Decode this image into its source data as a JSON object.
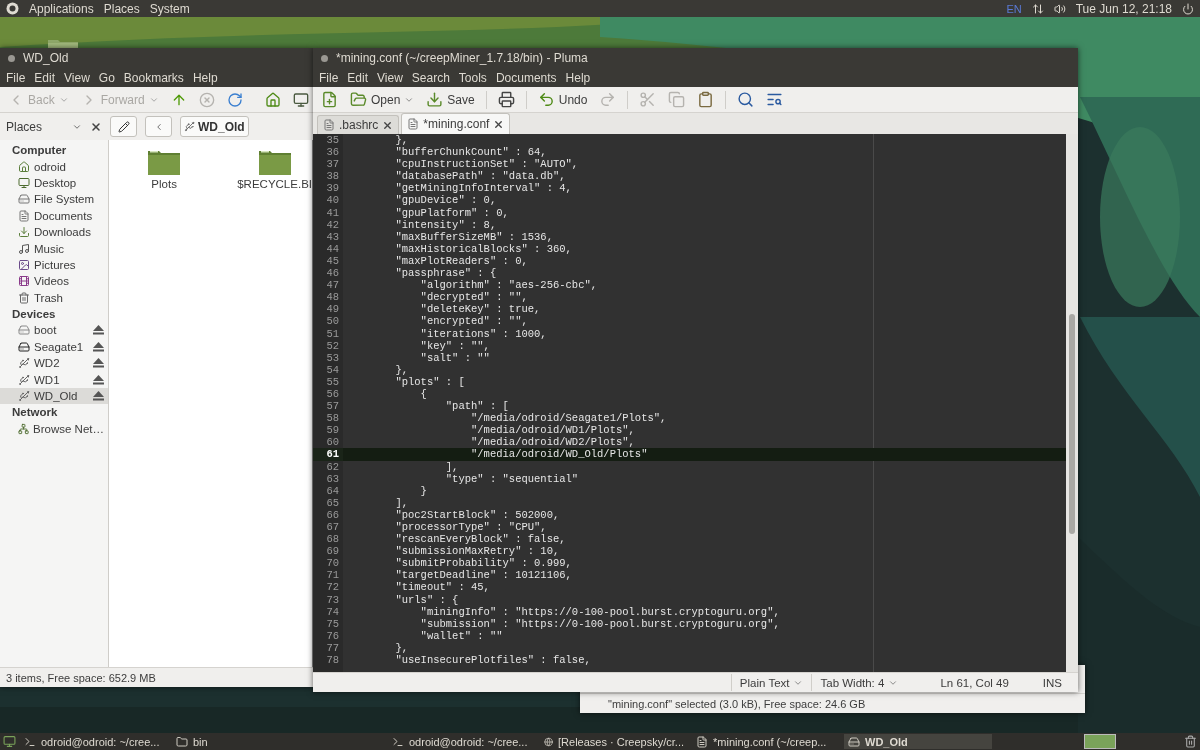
{
  "top_panel": {
    "menus": [
      "Applications",
      "Places",
      "System"
    ],
    "keyboard": "EN",
    "clock": "Tue Jun 12, 21:18"
  },
  "file_manager": {
    "title": "WD_Old",
    "menu": [
      "File",
      "Edit",
      "View",
      "Go",
      "Bookmarks",
      "Help"
    ],
    "toolbar": [
      {
        "kind": "back",
        "label": "Back",
        "disabled": true,
        "menu": true
      },
      {
        "kind": "forward",
        "label": "Forward",
        "disabled": true,
        "menu": true
      },
      {
        "kind": "up",
        "disabled": false
      },
      {
        "kind": "stop",
        "disabled": true
      },
      {
        "kind": "reload",
        "disabled": false
      },
      {
        "kind": "home",
        "disabled": false
      },
      {
        "kind": "computer",
        "disabled": false
      }
    ],
    "places_label": "Places",
    "path_button": "WD_Old",
    "sidebar": [
      {
        "heading": "Computer",
        "items": [
          {
            "label": "odroid",
            "kind": "home",
            "selected": false
          },
          {
            "label": "Desktop",
            "kind": "desktop",
            "selected": false
          },
          {
            "label": "File System",
            "kind": "filesystem",
            "selected": false
          },
          {
            "label": "Documents",
            "kind": "documents",
            "selected": false
          },
          {
            "label": "Downloads",
            "kind": "downloads",
            "selected": false
          },
          {
            "label": "Music",
            "kind": "music",
            "selected": false
          },
          {
            "label": "Pictures",
            "kind": "pictures",
            "selected": false
          },
          {
            "label": "Videos",
            "kind": "videos",
            "selected": false
          },
          {
            "label": "Trash",
            "kind": "trash",
            "selected": false
          }
        ]
      },
      {
        "heading": "Devices",
        "items": [
          {
            "label": "boot",
            "kind": "drive",
            "selected": false,
            "eject": true
          },
          {
            "label": "Seagate1",
            "kind": "disk",
            "selected": false,
            "eject": true
          },
          {
            "label": "WD2",
            "kind": "usb",
            "selected": false,
            "eject": true
          },
          {
            "label": "WD1",
            "kind": "usb",
            "selected": false,
            "eject": true
          },
          {
            "label": "WD_Old",
            "kind": "usb",
            "selected": true,
            "eject": true
          }
        ]
      },
      {
        "heading": "Network",
        "items": [
          {
            "label": "Browse Net…",
            "kind": "network",
            "selected": false
          }
        ]
      }
    ],
    "files": [
      {
        "name": "Plots"
      },
      {
        "name": "$RECYCLE.BI"
      }
    ],
    "status": "3 items, Free space: 652.9 MB"
  },
  "editor": {
    "title": "*mining.conf (~/creepMiner_1.7.18/bin) - Pluma",
    "menu": [
      "File",
      "Edit",
      "View",
      "Search",
      "Tools",
      "Documents",
      "Help"
    ],
    "toolbar": [
      [
        {
          "kind": "new",
          "disabled": false
        },
        {
          "kind": "open",
          "label": "Open",
          "menu": true,
          "disabled": false
        },
        {
          "kind": "save",
          "label": "Save",
          "disabled": false
        }
      ],
      [
        {
          "kind": "print",
          "disabled": false
        }
      ],
      [
        {
          "kind": "undo",
          "label": "Undo",
          "disabled": false
        },
        {
          "kind": "redo",
          "disabled": true
        }
      ],
      [
        {
          "kind": "cut",
          "disabled": true
        },
        {
          "kind": "copy",
          "disabled": true
        },
        {
          "kind": "paste",
          "disabled": false
        }
      ],
      [
        {
          "kind": "find",
          "disabled": false
        },
        {
          "kind": "replace",
          "disabled": false
        }
      ]
    ],
    "tabs": [
      {
        "label": ".bashrc",
        "selected": false
      },
      {
        "label": "*mining.conf",
        "selected": true
      }
    ],
    "lines": [
      {
        "number": "35",
        "text": "        },",
        "current": false
      },
      {
        "number": "36",
        "text": "        \"bufferChunkCount\" : 64,",
        "current": false
      },
      {
        "number": "37",
        "text": "        \"cpuInstructionSet\" : \"AUTO\",",
        "current": false
      },
      {
        "number": "38",
        "text": "        \"databasePath\" : \"data.db\",",
        "current": false
      },
      {
        "number": "39",
        "text": "        \"getMiningInfoInterval\" : 4,",
        "current": false
      },
      {
        "number": "40",
        "text": "        \"gpuDevice\" : 0,",
        "current": false
      },
      {
        "number": "41",
        "text": "        \"gpuPlatform\" : 0,",
        "current": false
      },
      {
        "number": "42",
        "text": "        \"intensity\" : 8,",
        "current": false
      },
      {
        "number": "43",
        "text": "        \"maxBufferSizeMB\" : 1536,",
        "current": false
      },
      {
        "number": "44",
        "text": "        \"maxHistoricalBlocks\" : 360,",
        "current": false
      },
      {
        "number": "45",
        "text": "        \"maxPlotReaders\" : 0,",
        "current": false
      },
      {
        "number": "46",
        "text": "        \"passphrase\" : {",
        "current": false
      },
      {
        "number": "47",
        "text": "            \"algorithm\" : \"aes-256-cbc\",",
        "current": false
      },
      {
        "number": "48",
        "text": "            \"decrypted\" : \"\",",
        "current": false
      },
      {
        "number": "49",
        "text": "            \"deleteKey\" : true,",
        "current": false
      },
      {
        "number": "50",
        "text": "            \"encrypted\" : \"\",",
        "current": false
      },
      {
        "number": "51",
        "text": "            \"iterations\" : 1000,",
        "current": false
      },
      {
        "number": "52",
        "text": "            \"key\" : \"\",",
        "current": false
      },
      {
        "number": "53",
        "text": "            \"salt\" : \"\"",
        "current": false
      },
      {
        "number": "54",
        "text": "        },",
        "current": false
      },
      {
        "number": "55",
        "text": "        \"plots\" : [",
        "current": false
      },
      {
        "number": "56",
        "text": "            {",
        "current": false
      },
      {
        "number": "57",
        "text": "                \"path\" : [",
        "current": false
      },
      {
        "number": "58",
        "text": "                    \"/media/odroid/Seagate1/Plots\",",
        "current": false
      },
      {
        "number": "59",
        "text": "                    \"/media/odroid/WD1/Plots\",",
        "current": false
      },
      {
        "number": "60",
        "text": "                    \"/media/odroid/WD2/Plots\",",
        "current": false
      },
      {
        "number": "61",
        "text": "                    \"/media/odroid/WD_Old/Plots\"",
        "current": true
      },
      {
        "number": "62",
        "text": "                ],",
        "current": false
      },
      {
        "number": "63",
        "text": "                \"type\" : \"sequential\"",
        "current": false
      },
      {
        "number": "64",
        "text": "            }",
        "current": false
      },
      {
        "number": "65",
        "text": "        ],",
        "current": false
      },
      {
        "number": "66",
        "text": "        \"poc2StartBlock\" : 502000,",
        "current": false
      },
      {
        "number": "67",
        "text": "        \"processorType\" : \"CPU\",",
        "current": false
      },
      {
        "number": "68",
        "text": "        \"rescanEveryBlock\" : false,",
        "current": false
      },
      {
        "number": "69",
        "text": "        \"submissionMaxRetry\" : 10,",
        "current": false
      },
      {
        "number": "70",
        "text": "        \"submitProbability\" : 0.999,",
        "current": false
      },
      {
        "number": "71",
        "text": "        \"targetDeadline\" : 10121106,",
        "current": false
      },
      {
        "number": "72",
        "text": "        \"timeout\" : 45,",
        "current": false
      },
      {
        "number": "73",
        "text": "        \"urls\" : {",
        "current": false
      },
      {
        "number": "74",
        "text": "            \"miningInfo\" : \"https://0-100-pool.burst.cryptoguru.org\",",
        "current": false
      },
      {
        "number": "75",
        "text": "            \"submission\" : \"https://0-100-pool.burst.cryptoguru.org\",",
        "current": false
      },
      {
        "number": "76",
        "text": "            \"wallet\" : \"\"",
        "current": false
      },
      {
        "number": "77",
        "text": "        },",
        "current": false
      },
      {
        "number": "78",
        "text": "        \"useInsecurePlotfiles\" : false,",
        "current": false
      }
    ],
    "status": [
      {
        "kind": "dropdown",
        "text": "Plain Text"
      },
      {
        "kind": "dropdown",
        "text": "Tab Width: 4"
      },
      {
        "kind": "text",
        "text": "Ln 61, Col 49"
      },
      {
        "kind": "text",
        "text": "INS"
      }
    ]
  },
  "background_window": {
    "status": "\"mining.conf\" selected (3.0 kB), Free space: 24.6 GB"
  },
  "taskbar": {
    "items": [
      {
        "label": "odroid@odroid: ~/cree...",
        "kind": "terminal",
        "selected": false
      },
      {
        "label": "bin",
        "kind": "folder",
        "selected": false
      },
      {
        "label": "odroid@odroid: ~/cree...",
        "kind": "terminal",
        "selected": false
      },
      {
        "label": "[Releases · Creepsky/cr...",
        "kind": "browser",
        "selected": false
      },
      {
        "label": "*mining.conf (~/creep...",
        "kind": "editor",
        "selected": false
      },
      {
        "label": "WD_Old",
        "kind": "drive",
        "selected": true
      }
    ]
  }
}
